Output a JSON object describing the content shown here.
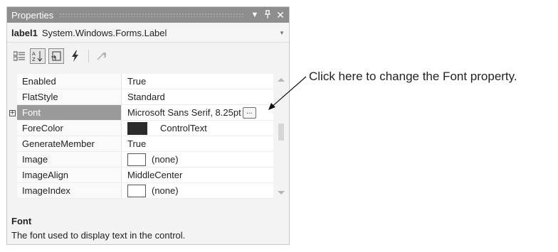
{
  "panel": {
    "title": "Properties",
    "title_icons": [
      "dropdown-arrow-icon",
      "pin-icon",
      "close-icon"
    ],
    "object_name": "label1",
    "object_type": "System.Windows.Forms.Label"
  },
  "toolbar": {
    "buttons": [
      "categorized-icon",
      "alphabetical-icon",
      "properties-icon",
      "events-icon",
      "property-pages-icon"
    ]
  },
  "grid": {
    "rows": [
      {
        "name": "Enabled",
        "value": "True"
      },
      {
        "name": "FlatStyle",
        "value": "Standard"
      },
      {
        "name": "Font",
        "value": "Microsoft Sans Serif, 8.25pt",
        "expander": "+",
        "button": "..."
      },
      {
        "name": "ForeColor",
        "value": "ControlText",
        "swatch_color": "#2b2b2b"
      },
      {
        "name": "GenerateMember",
        "value": "True"
      },
      {
        "name": "Image",
        "value": "(none)"
      },
      {
        "name": "ImageAlign",
        "value": "MiddleCenter"
      },
      {
        "name": "ImageIndex",
        "value": "(none)"
      }
    ],
    "selected_row": "Font"
  },
  "description": {
    "title": "Font",
    "text": "The font used to display text in the control."
  },
  "callout": {
    "text": "Click here to change the Font property."
  },
  "colors": {
    "title_bar": "#8e8e8e",
    "selected_row": "#9a9a9a"
  }
}
